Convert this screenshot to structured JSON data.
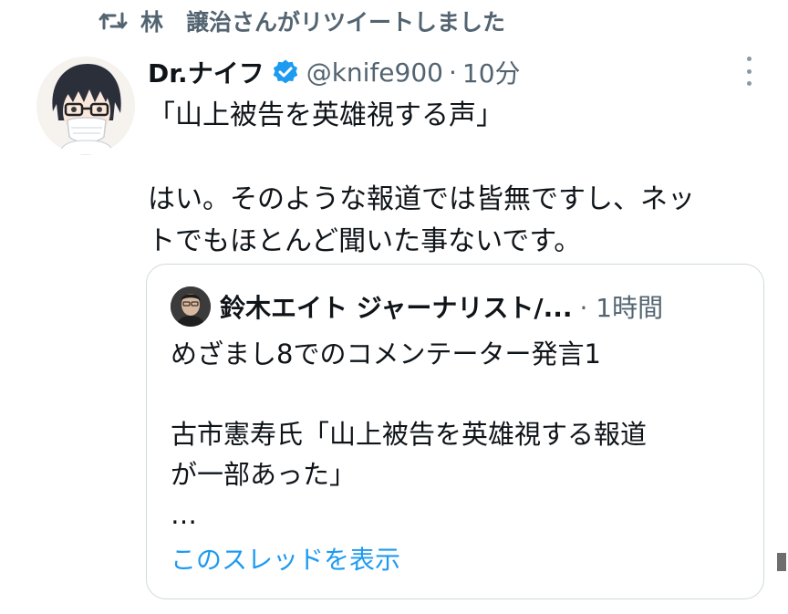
{
  "retweet": {
    "label": "林　譲治さんがリツイートしました",
    "icon": "retweet-icon"
  },
  "tweet": {
    "display_name": "Dr.ナイフ",
    "handle": "@knife900",
    "separator": "·",
    "time": "10分",
    "verified_icon": "verified-badge-icon",
    "more_icon": "more-vertical-icon",
    "text_lines": [
      "「山上被告を英雄視する声」",
      "",
      "はい。そのような報道では皆無ですし、ネッ",
      "トでもほとんど聞いた事ないです。"
    ]
  },
  "quote": {
    "name": "鈴木エイト ジャーナリスト/...",
    "meta": "· 1時間",
    "text_lines": [
      "めざまし8でのコメンテーター発言1",
      "",
      "古市憲寿氏「山上被告を英雄視する報道",
      "が一部あった」",
      "…"
    ],
    "show_thread": "このスレッドを表示"
  },
  "colors": {
    "text": "#0f1419",
    "secondary": "#536471",
    "link": "#1d9bf0",
    "verified": "#1d9bf0",
    "border": "#cfd9de"
  }
}
